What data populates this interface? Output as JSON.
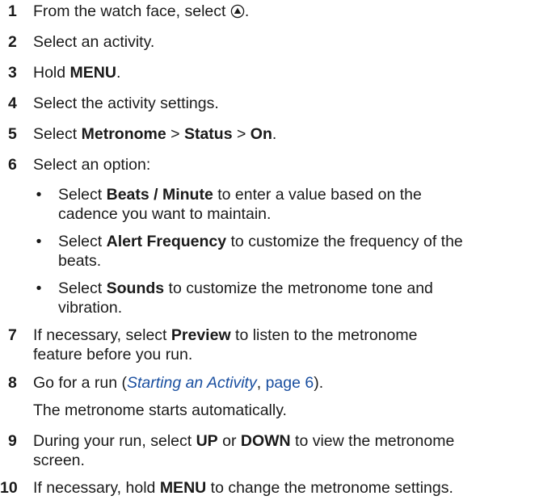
{
  "steps": [
    {
      "number": "1",
      "pre": "From the watch face, select",
      "post": "."
    },
    {
      "number": "2",
      "text": "Select an activity."
    },
    {
      "number": "3",
      "pre": "Hold",
      "bold": "MENU",
      "post": "."
    },
    {
      "number": "4",
      "text": "Select the activity settings."
    },
    {
      "number": "5",
      "pre": "Select",
      "bold1": "Metronome",
      "sep1": ">",
      "bold2": "Status",
      "sep2": ">",
      "bold3": "On",
      "post": "."
    },
    {
      "number": "6",
      "text": "Select an option:",
      "options": [
        {
          "pre": "Select",
          "bold": "Beats / Minute",
          "line1_rest": "to enter a value based on the",
          "line2": "cadence you want to maintain."
        },
        {
          "pre": "Select",
          "bold": "Alert Frequency",
          "line1_rest": "to customize the frequency of the",
          "line2": "beats."
        },
        {
          "pre": "Select",
          "bold": "Sounds",
          "line1_rest": "to customize the metronome tone and",
          "line2": "vibration."
        }
      ]
    },
    {
      "number": "7",
      "pre": "If necessary, select",
      "bold": "Preview",
      "line1_rest": "to listen to the metronome",
      "line2": "feature before you run."
    },
    {
      "number": "8",
      "pre": "Go for a run (",
      "link": "Starting an Activity",
      "mid": ", ",
      "page_ref": "page 6",
      "post": ").",
      "note": "The metronome starts automatically."
    },
    {
      "number": "9",
      "pre": "During your run, select",
      "bold1": "UP",
      "mid": "or",
      "bold2": "DOWN",
      "line1_rest": "to view the metronome",
      "line2": "screen."
    },
    {
      "number": "10",
      "pre": "If necessary, hold",
      "bold": "MENU",
      "post": "to change the metronome settings."
    }
  ],
  "icons": {
    "step1": "up-button-icon"
  }
}
